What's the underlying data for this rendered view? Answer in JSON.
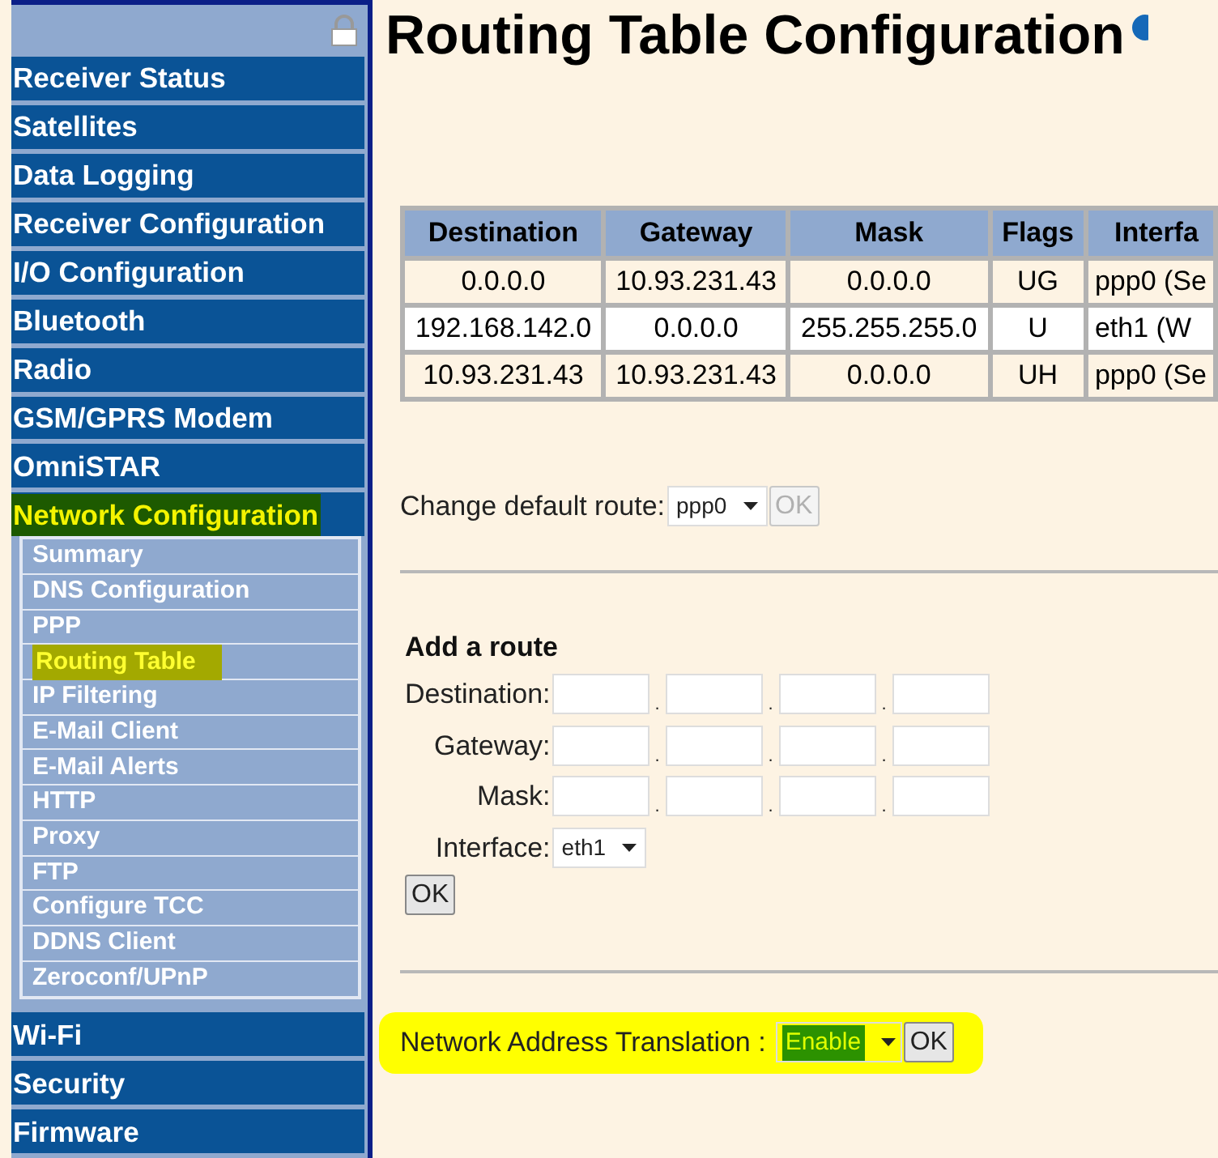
{
  "sidebar": {
    "items": [
      {
        "label": "Receiver Status",
        "selected": false
      },
      {
        "label": "Satellites",
        "selected": false
      },
      {
        "label": "Data Logging",
        "selected": false
      },
      {
        "label": "Receiver Configuration",
        "selected": false
      },
      {
        "label": "I/O Configuration",
        "selected": false
      },
      {
        "label": "Bluetooth",
        "selected": false
      },
      {
        "label": "Radio",
        "selected": false
      },
      {
        "label": "GSM/GPRS Modem",
        "selected": false
      },
      {
        "label": "OmniSTAR",
        "selected": false
      },
      {
        "label": "Network Configuration",
        "selected": true,
        "children": [
          {
            "label": "Summary",
            "selected": false
          },
          {
            "label": "DNS Configuration",
            "selected": false
          },
          {
            "label": "PPP",
            "selected": false
          },
          {
            "label": "Routing Table",
            "selected": true
          },
          {
            "label": "IP Filtering",
            "selected": false
          },
          {
            "label": "E-Mail Client",
            "selected": false
          },
          {
            "label": "E-Mail Alerts",
            "selected": false
          },
          {
            "label": "HTTP",
            "selected": false
          },
          {
            "label": "Proxy",
            "selected": false
          },
          {
            "label": "FTP",
            "selected": false
          },
          {
            "label": "Configure TCC",
            "selected": false
          },
          {
            "label": "DDNS Client",
            "selected": false
          },
          {
            "label": "Zeroconf/UPnP",
            "selected": false
          }
        ]
      },
      {
        "label": "Wi-Fi",
        "selected": false
      },
      {
        "label": "Security",
        "selected": false
      },
      {
        "label": "Firmware",
        "selected": false
      }
    ]
  },
  "page_title": "Routing Table Configuration",
  "routing_table": {
    "columns": [
      "Destination",
      "Gateway",
      "Mask",
      "Flags",
      "Interfa"
    ],
    "rows": [
      [
        "0.0.0.0",
        "10.93.231.43",
        "0.0.0.0",
        "UG",
        "ppp0 (Se"
      ],
      [
        "192.168.142.0",
        "0.0.0.0",
        "255.255.255.0",
        "U",
        "eth1 (W"
      ],
      [
        "10.93.231.43",
        "10.93.231.43",
        "0.0.0.0",
        "UH",
        "ppp0 (Se"
      ]
    ]
  },
  "default_route": {
    "label": "Change default route:",
    "value": "ppp0",
    "button": {
      "label": "OK",
      "disabled": true
    }
  },
  "add_route": {
    "title": "Add a route",
    "fields": [
      {
        "label": "Destination:",
        "dots": [
          ".",
          ".",
          "."
        ]
      },
      {
        "label": "Gateway:",
        "dots": [
          ".",
          ".",
          "."
        ]
      },
      {
        "label": "Mask:",
        "dots": [
          ".",
          ".",
          "."
        ]
      }
    ],
    "interface": {
      "label": "Interface:",
      "value": "eth1"
    },
    "button": {
      "label": "OK",
      "disabled": false
    }
  },
  "nat": {
    "label": "Network Address Translation :",
    "value": "Enable",
    "button": "OK",
    "highlighted": true
  }
}
